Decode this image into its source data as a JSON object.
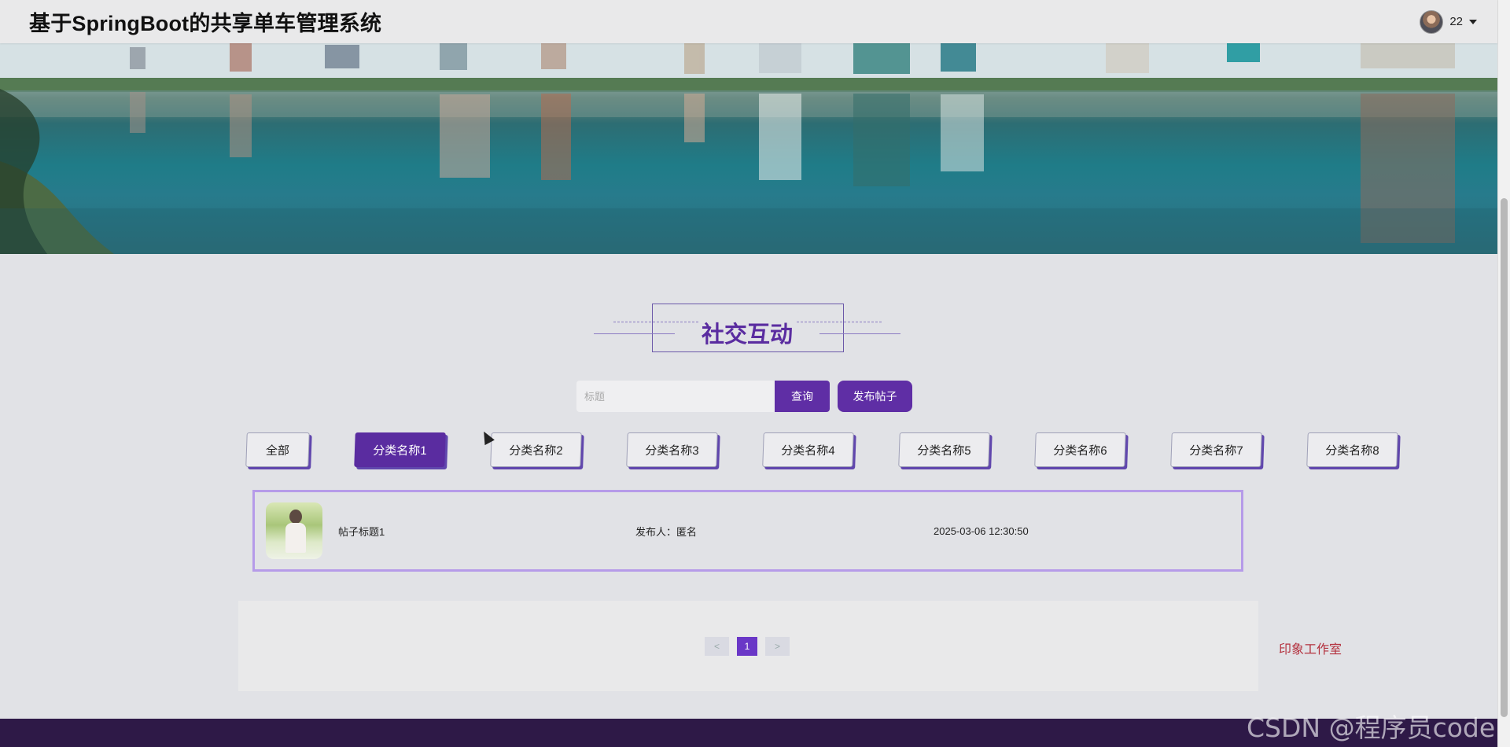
{
  "header": {
    "title": "基于SpringBoot的共享单车管理系统",
    "username": "22"
  },
  "section": {
    "title": "社交互动"
  },
  "search": {
    "placeholder": "标题",
    "query_label": "查询",
    "post_label": "发布帖子"
  },
  "categories": [
    "全部",
    "分类名称1",
    "分类名称2",
    "分类名称3",
    "分类名称4",
    "分类名称5",
    "分类名称6",
    "分类名称7",
    "分类名称8"
  ],
  "active_category": "分类名称1",
  "posts": [
    {
      "title": "帖子标题1",
      "author": "发布人：匿名",
      "time": "2025-03-06 12:30:50"
    }
  ],
  "pager": {
    "prev": "<",
    "current": "1",
    "next": ">"
  },
  "studio": "印象工作室",
  "watermark": "CSDN @程序员code",
  "colors": {
    "primary": "#5a2ca0",
    "accent_border": "#b69be9",
    "footer": "#2e1947",
    "studio_text": "#b3303d"
  }
}
